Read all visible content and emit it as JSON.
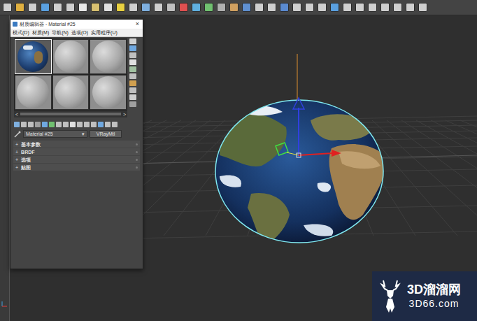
{
  "material_editor": {
    "title": "材质编辑器 - Material #25",
    "close": "×",
    "menu": [
      "模式(D)",
      "材质(M)",
      "导航(N)",
      "选项(O)",
      "实用程序(U)"
    ],
    "slots": [
      {
        "kind": "earth",
        "selected": true
      },
      {
        "kind": "plain",
        "selected": false
      },
      {
        "kind": "plain",
        "selected": false
      },
      {
        "kind": "plain",
        "selected": false
      },
      {
        "kind": "plain",
        "selected": false
      },
      {
        "kind": "plain",
        "selected": false
      }
    ],
    "scroll": {
      "left": "<",
      "right": ">"
    },
    "material_name": "Material #25",
    "dropdown_glyph": "▾",
    "material_type": "VRayMtl",
    "rollouts": [
      {
        "label": "基本参数",
        "glyph": "+",
        "expanded": false
      },
      {
        "label": "BRDF",
        "glyph": "+",
        "expanded": false
      },
      {
        "label": "选项",
        "glyph": "+",
        "expanded": false
      },
      {
        "label": "贴图",
        "glyph": "+",
        "expanded": false
      }
    ]
  },
  "viewport": {
    "object_selected": true
  },
  "watermark": {
    "title": "3D溜溜网",
    "subtitle": "3D66.com"
  }
}
